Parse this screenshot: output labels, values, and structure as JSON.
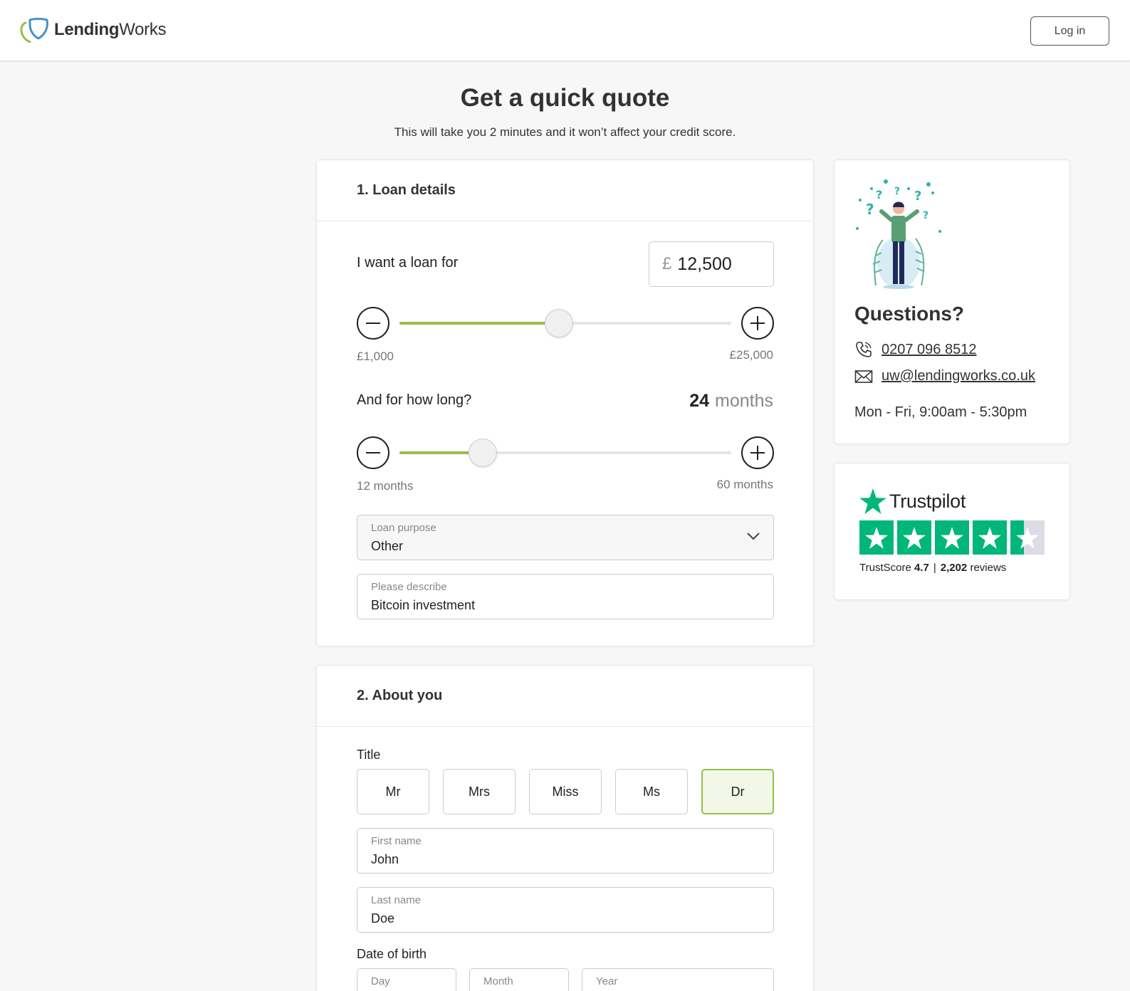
{
  "header": {
    "logo_bold": "Lending",
    "logo_light": "Works",
    "login_label": "Log in"
  },
  "intro": {
    "title": "Get a quick quote",
    "subtitle": "This will take you 2 minutes and it won’t affect your credit score."
  },
  "loan": {
    "section_title": "1. Loan details",
    "amount_label": "I want a loan for",
    "currency_symbol": "£",
    "amount_value": "12,500",
    "amount_min_label": "£1,000",
    "amount_max_label": "£25,000",
    "amount_fraction": 0.48,
    "duration_label": "And for how long?",
    "duration_value": "24",
    "duration_unit": "months",
    "duration_min_label": "12 months",
    "duration_max_label": "60 months",
    "duration_fraction": 0.25,
    "purpose": {
      "label": "Loan purpose",
      "value": "Other"
    },
    "describe": {
      "label": "Please describe",
      "value": "Bitcoin investment"
    }
  },
  "about": {
    "section_title": "2. About you",
    "title_label": "Title",
    "title_options": [
      "Mr",
      "Mrs",
      "Miss",
      "Ms",
      "Dr"
    ],
    "title_selected": "Dr",
    "first_name": {
      "label": "First name",
      "value": "John"
    },
    "last_name": {
      "label": "Last name",
      "value": "Doe"
    },
    "dob_label": "Date of birth",
    "dob_fields": {
      "day": "Day",
      "month": "Month",
      "year": "Year"
    }
  },
  "help": {
    "title": "Questions?",
    "phone": "0207 096 8512",
    "email": "uw@lendingworks.co.uk",
    "hours": "Mon - Fri, 9:00am - 5:30pm"
  },
  "trustpilot": {
    "brand": "Trustpilot",
    "score_label": "TrustScore",
    "score": "4.7",
    "separator": "|",
    "reviews_count": "2,202",
    "reviews_label": "reviews",
    "rating": 4.7
  },
  "colors": {
    "accent_green": "#9bbb48",
    "trustpilot_green": "#00b67a",
    "logo_blue": "#4a90c8"
  }
}
